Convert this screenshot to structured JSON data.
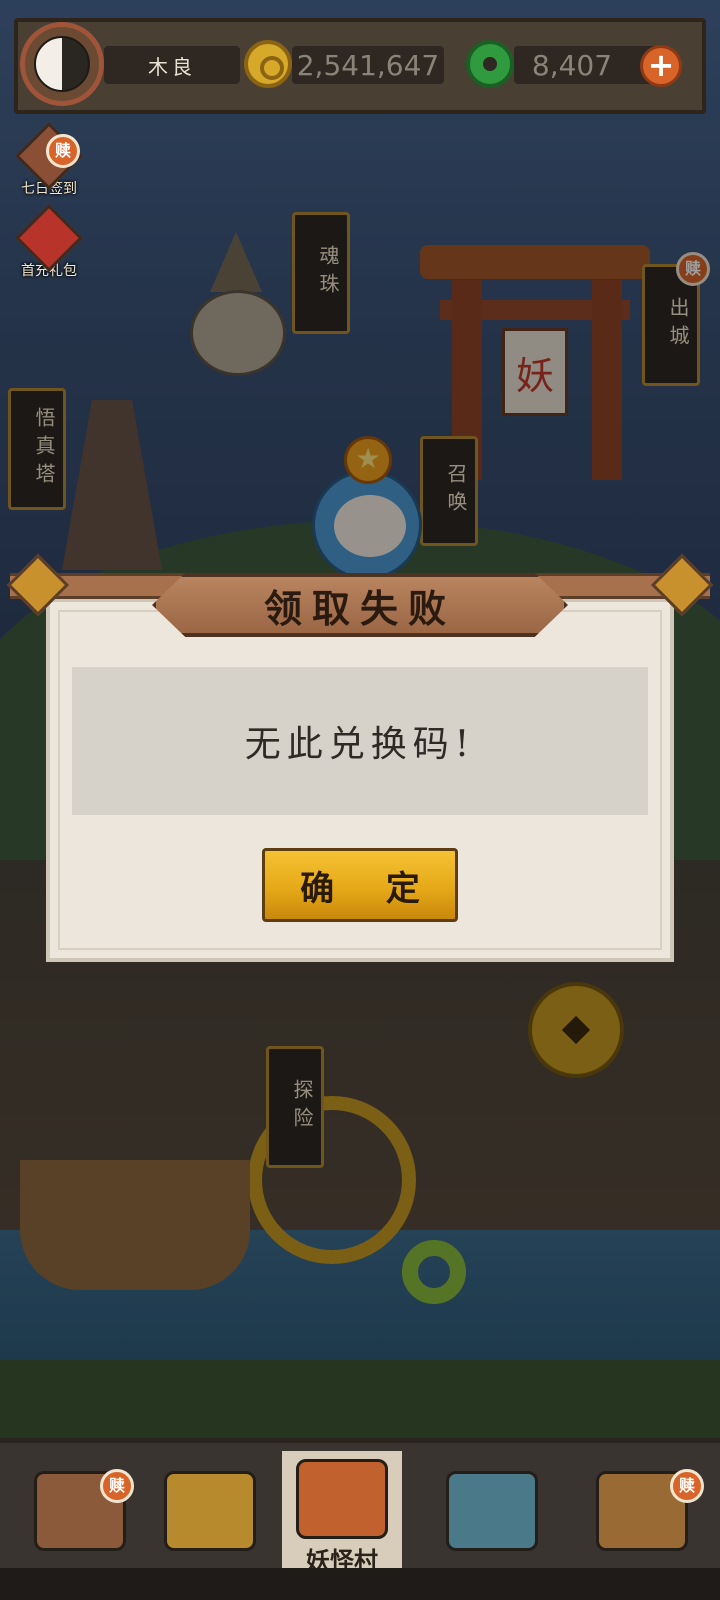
{
  "header": {
    "player_name": "木良",
    "coins": "2,541,647",
    "jade": "8,407",
    "add_label": "+"
  },
  "side_buttons": [
    {
      "label": "七日签到",
      "badge": "赎"
    },
    {
      "label": "首充礼包"
    }
  ],
  "map_signs": {
    "soul_orb": "魂珠",
    "leave_city": "出城",
    "wuzhen_tower": "悟真塔",
    "summon": "召唤",
    "explore": "探险",
    "torii_sign": "妖"
  },
  "badges": {
    "leave_city": "赎",
    "nav_left": "赎",
    "nav_right": "赎"
  },
  "dialog": {
    "title": "领取失败",
    "message": "无此兑换码!",
    "confirm_label": "确 定"
  },
  "bottom_nav": {
    "active_label": "妖怪村"
  },
  "colors": {
    "accent_gold": "#e6a918",
    "badge_orange": "#d9642a",
    "dialog_bg": "#ece6dc"
  }
}
